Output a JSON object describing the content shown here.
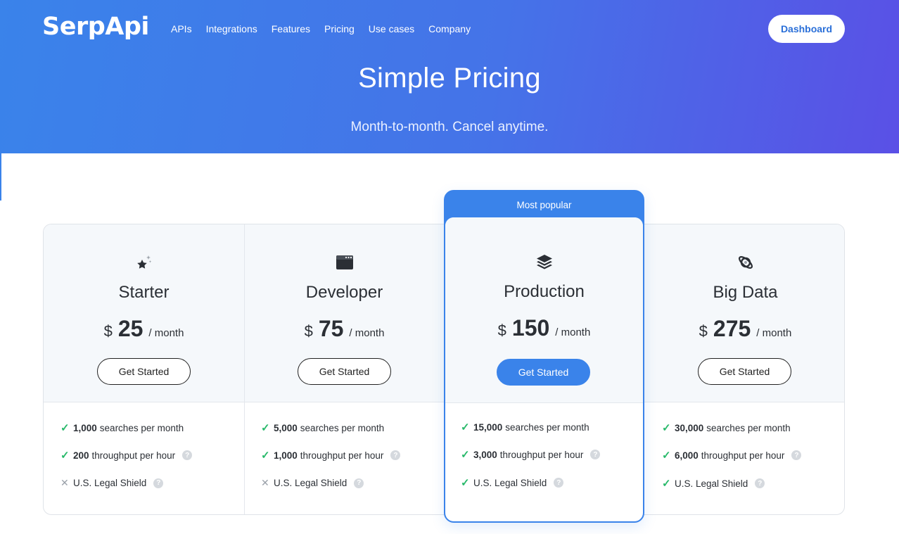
{
  "header": {
    "logo": "SerpApi",
    "nav": [
      "APIs",
      "Integrations",
      "Features",
      "Pricing",
      "Use cases",
      "Company"
    ],
    "dashboard_label": "Dashboard"
  },
  "hero": {
    "title": "Simple Pricing",
    "subtitle": "Month-to-month. Cancel anytime."
  },
  "popular_label": "Most popular",
  "plans": [
    {
      "name": "Starter",
      "icon": "star-sparkle-icon",
      "currency": "$",
      "price": "25",
      "period": "/ month",
      "cta": "Get Started",
      "features": [
        {
          "bold": "1,000",
          "text": "searches per month",
          "included": true,
          "help": false
        },
        {
          "bold": "200",
          "text": "throughput per hour",
          "included": true,
          "help": true
        },
        {
          "bold": "",
          "text": "U.S. Legal Shield",
          "included": false,
          "help": true
        }
      ]
    },
    {
      "name": "Developer",
      "icon": "browser-window-icon",
      "currency": "$",
      "price": "75",
      "period": "/ month",
      "cta": "Get Started",
      "features": [
        {
          "bold": "5,000",
          "text": "searches per month",
          "included": true,
          "help": false
        },
        {
          "bold": "1,000",
          "text": "throughput per hour",
          "included": true,
          "help": true
        },
        {
          "bold": "",
          "text": "U.S. Legal Shield",
          "included": false,
          "help": true
        }
      ]
    },
    {
      "name": "Production",
      "icon": "layers-icon",
      "currency": "$",
      "price": "150",
      "period": "/ month",
      "cta": "Get Started",
      "features": [
        {
          "bold": "15,000",
          "text": "searches per month",
          "included": true,
          "help": false
        },
        {
          "bold": "3,000",
          "text": "throughput per hour",
          "included": true,
          "help": true
        },
        {
          "bold": "",
          "text": "U.S. Legal Shield",
          "included": true,
          "help": true
        }
      ]
    },
    {
      "name": "Big Data",
      "icon": "planet-icon",
      "currency": "$",
      "price": "275",
      "period": "/ month",
      "cta": "Get Started",
      "features": [
        {
          "bold": "30,000",
          "text": "searches per month",
          "included": true,
          "help": false
        },
        {
          "bold": "6,000",
          "text": "throughput per hour",
          "included": true,
          "help": true
        },
        {
          "bold": "",
          "text": "U.S. Legal Shield",
          "included": true,
          "help": true
        }
      ]
    }
  ],
  "colors": {
    "accent": "#3a83ea",
    "check": "#28b96a",
    "cross": "#9aa1a9",
    "gradient_end": "#5a50e6"
  }
}
